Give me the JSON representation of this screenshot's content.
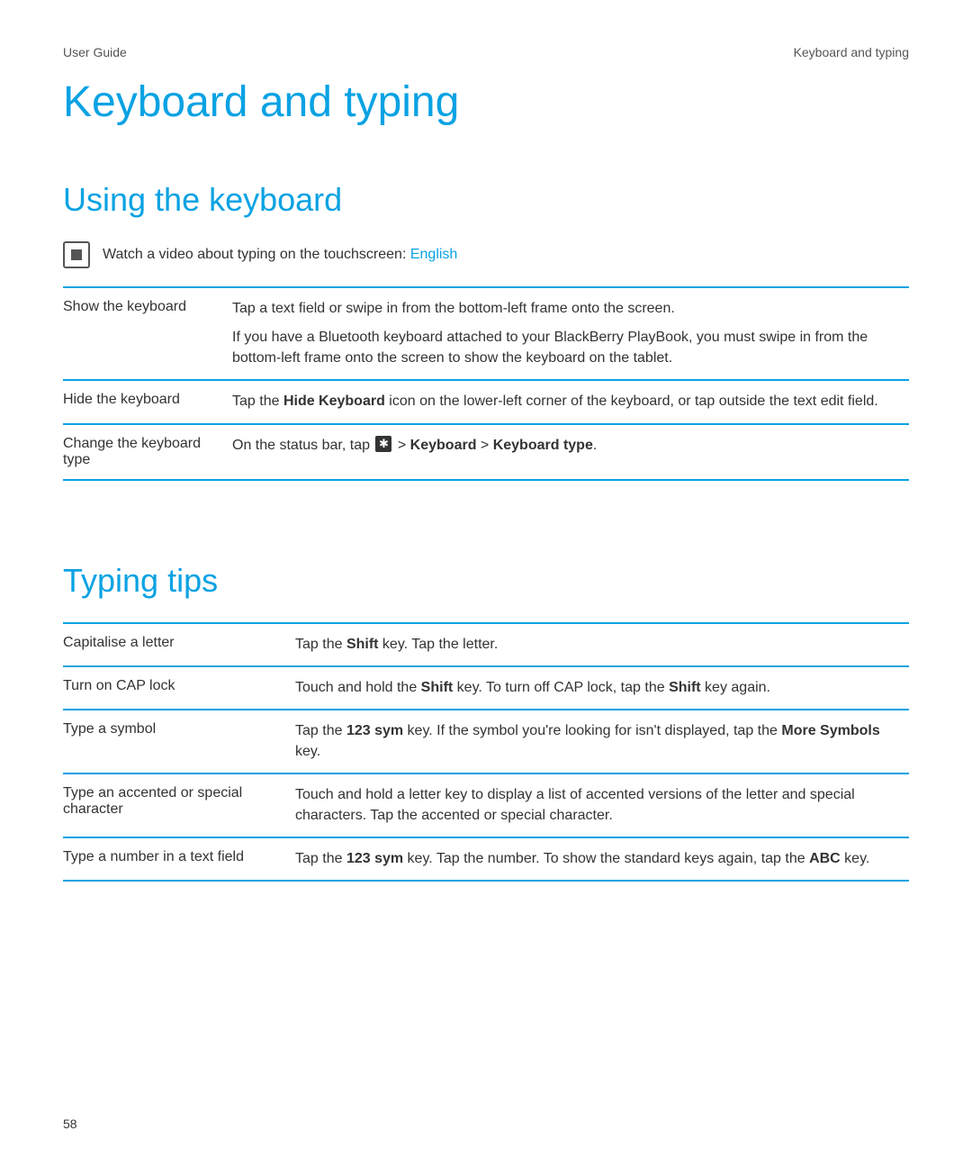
{
  "header": {
    "left": "User Guide",
    "right": "Keyboard and typing"
  },
  "title": "Keyboard and typing",
  "section1": {
    "heading": "Using the keyboard",
    "video_lead": "Watch a video about typing on the touchscreen: ",
    "video_link": "English",
    "rows": [
      {
        "label": "Show the keyboard",
        "paras": [
          {
            "segments": [
              {
                "t": "Tap a text field or swipe in from the bottom-left frame onto the screen."
              }
            ]
          },
          {
            "segments": [
              {
                "t": "If you have a Bluetooth keyboard attached to your BlackBerry PlayBook, you must swipe in from the bottom-left frame onto the screen to show the keyboard on the tablet."
              }
            ]
          }
        ]
      },
      {
        "label": "Hide the keyboard",
        "paras": [
          {
            "segments": [
              {
                "t": "Tap the "
              },
              {
                "t": "Hide Keyboard",
                "b": true
              },
              {
                "t": " icon on the lower-left corner of the keyboard, or tap outside the text edit field."
              }
            ]
          }
        ]
      },
      {
        "label": "Change the keyboard type",
        "paras": [
          {
            "segments": [
              {
                "t": "On the status bar, tap "
              },
              {
                "icon": "settings"
              },
              {
                "t": "  > "
              },
              {
                "t": "Keyboard",
                "b": true
              },
              {
                "t": " > "
              },
              {
                "t": "Keyboard type",
                "b": true
              },
              {
                "t": "."
              }
            ]
          }
        ]
      }
    ]
  },
  "section2": {
    "heading": "Typing tips",
    "rows": [
      {
        "label": "Capitalise a letter",
        "paras": [
          {
            "segments": [
              {
                "t": "Tap the "
              },
              {
                "t": "Shift",
                "b": true
              },
              {
                "t": " key. Tap the letter."
              }
            ]
          }
        ]
      },
      {
        "label": "Turn on CAP lock",
        "paras": [
          {
            "segments": [
              {
                "t": "Touch and hold the "
              },
              {
                "t": "Shift",
                "b": true
              },
              {
                "t": " key. To turn off CAP lock, tap the "
              },
              {
                "t": "Shift",
                "b": true
              },
              {
                "t": " key again."
              }
            ]
          }
        ]
      },
      {
        "label": "Type a symbol",
        "paras": [
          {
            "segments": [
              {
                "t": "Tap the "
              },
              {
                "t": "123 sym",
                "b": true
              },
              {
                "t": " key. If the symbol you're looking for isn't displayed, tap the "
              },
              {
                "t": "More Symbols",
                "b": true
              },
              {
                "t": " key."
              }
            ]
          }
        ]
      },
      {
        "label": "Type an accented or special character",
        "paras": [
          {
            "segments": [
              {
                "t": "Touch and hold a letter key to display a list of accented versions of the letter and special characters. Tap the accented or special character."
              }
            ]
          }
        ]
      },
      {
        "label": "Type a number in a text field",
        "paras": [
          {
            "segments": [
              {
                "t": "Tap the "
              },
              {
                "t": "123 sym",
                "b": true
              },
              {
                "t": " key. Tap the number. To show the standard keys again, tap the "
              },
              {
                "t": "ABC",
                "b": true
              },
              {
                "t": " key."
              }
            ]
          }
        ]
      }
    ]
  },
  "page_number": "58"
}
